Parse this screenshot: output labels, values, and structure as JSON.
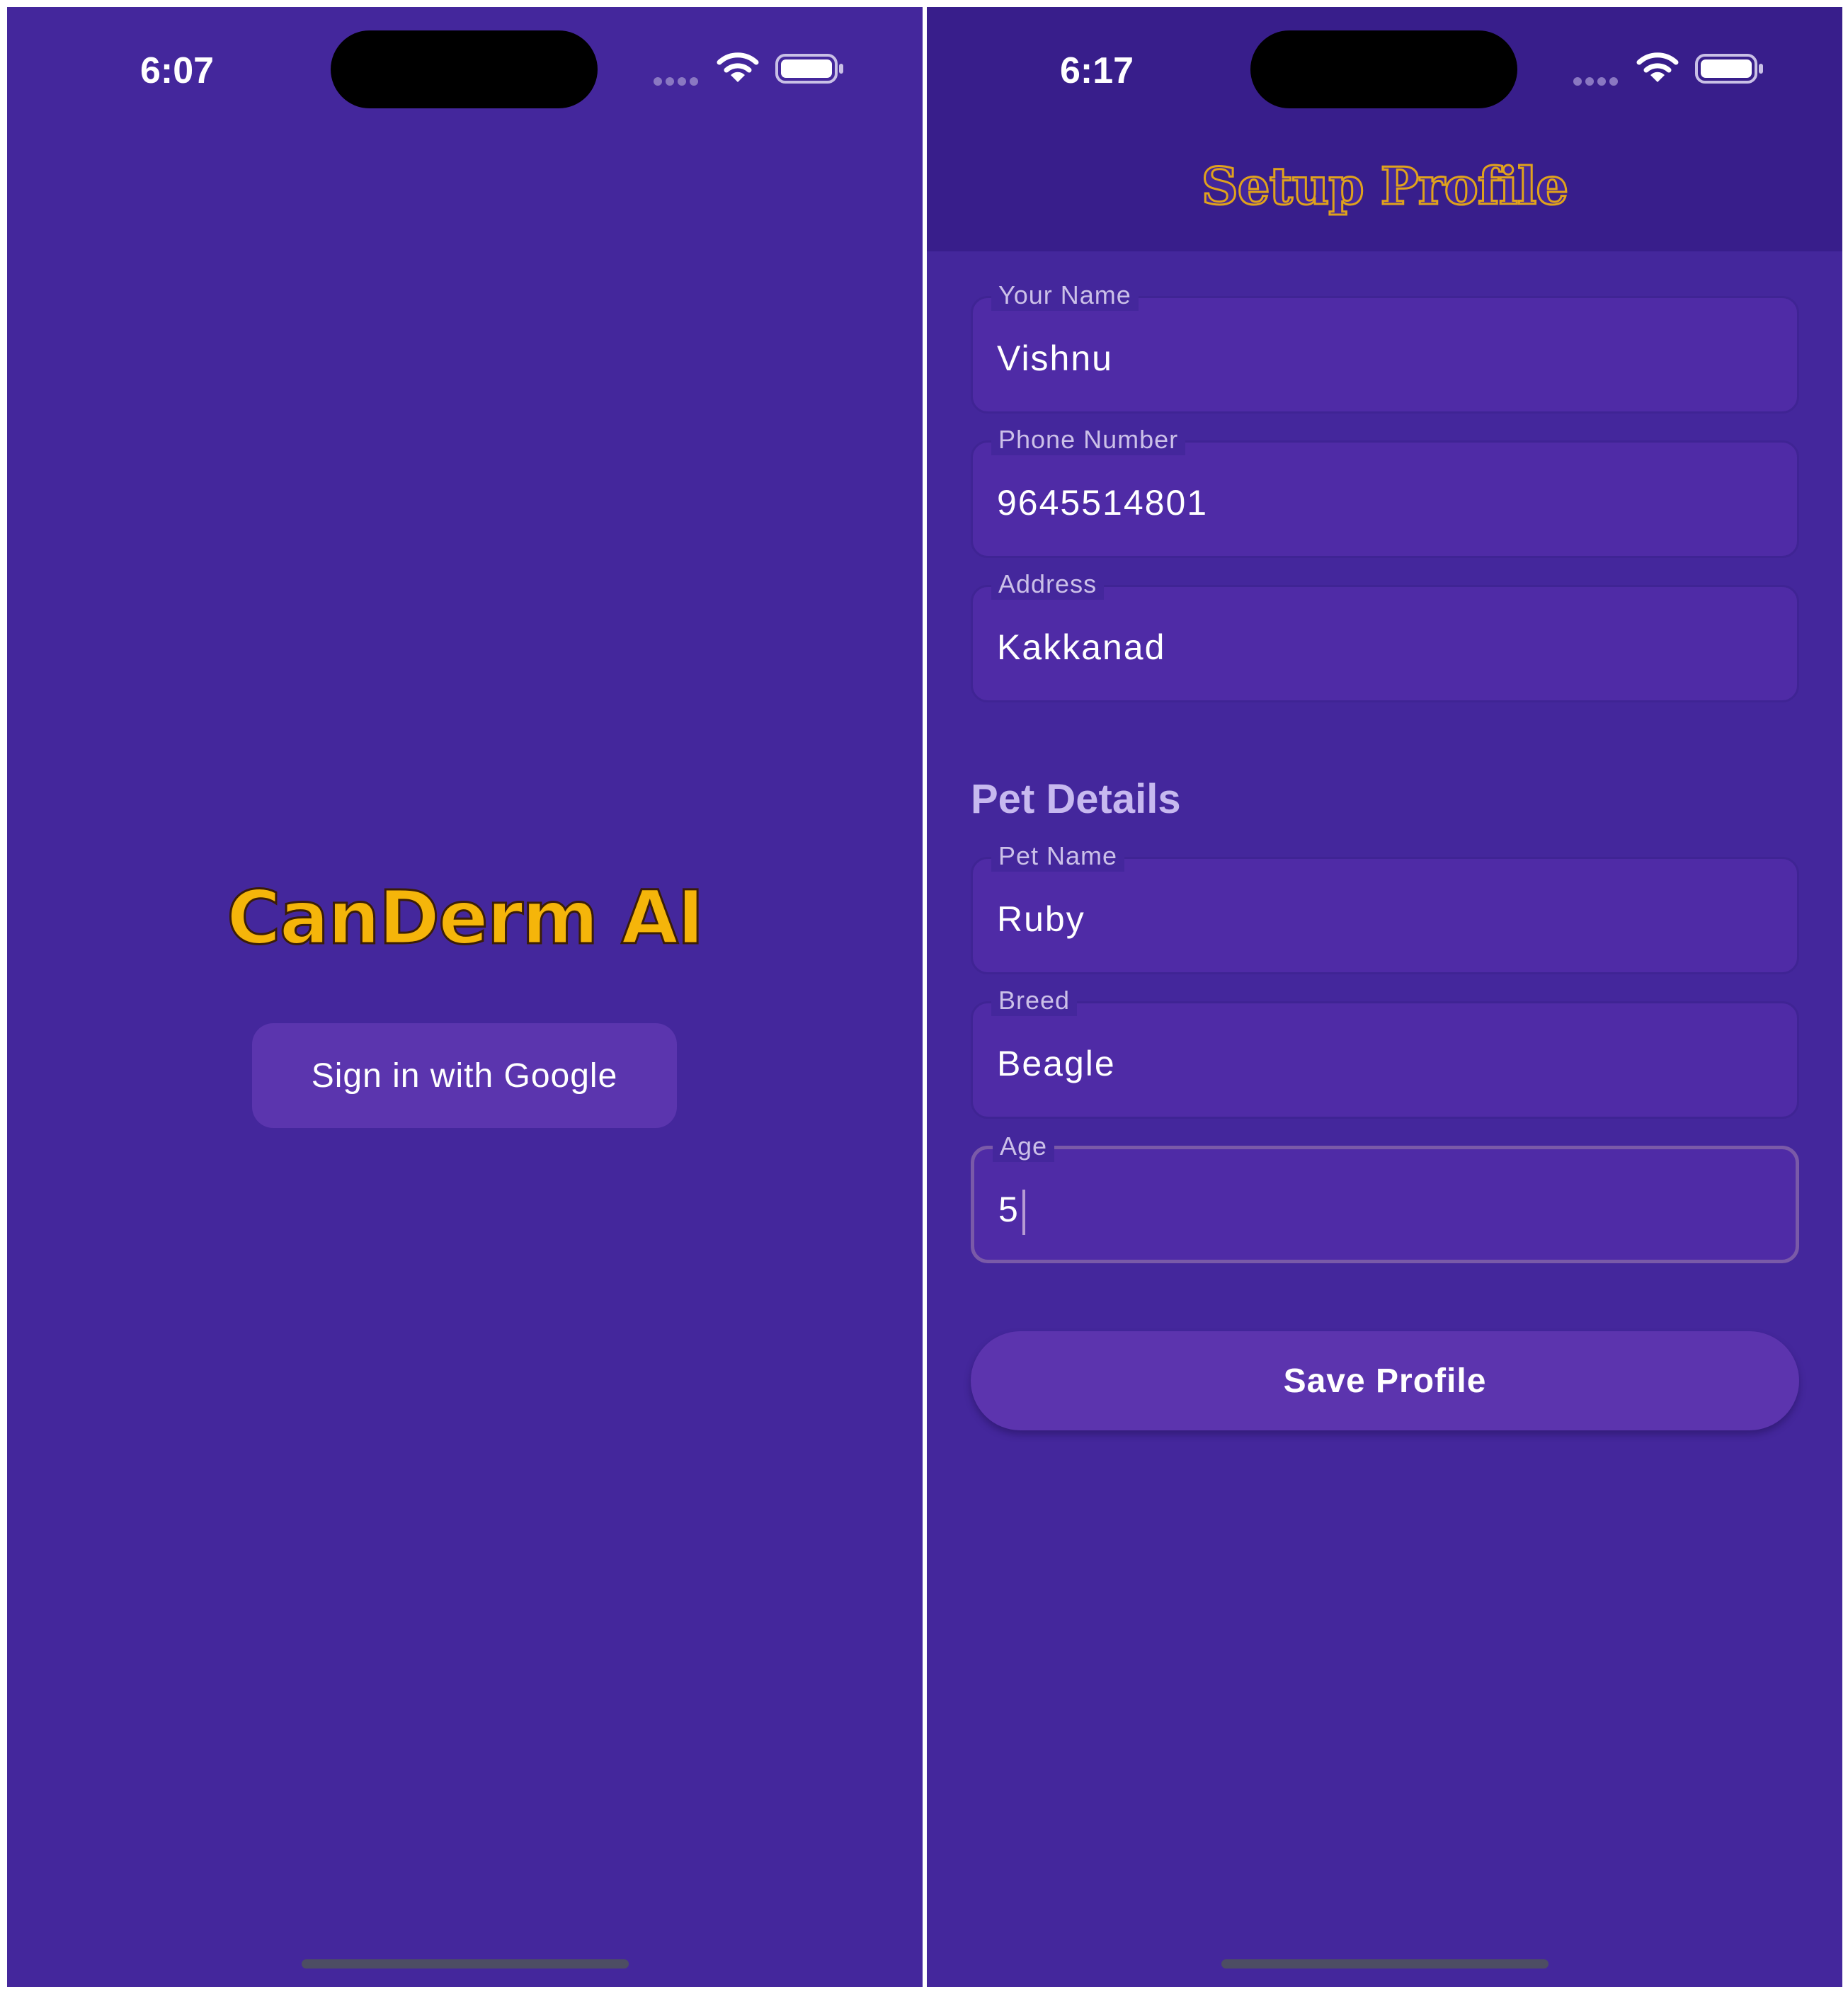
{
  "colors": {
    "background": "#44279c",
    "app_bar": "#381e8b",
    "field_fill": "#4f2ba6",
    "button_fill": "#5b35ae",
    "logo_yellow": "#f5b50a",
    "title_orange": "#e0a21c"
  },
  "left_screen": {
    "status_bar": {
      "time": "6:07",
      "icons": [
        "signal-icon",
        "wifi-icon",
        "battery-icon"
      ]
    },
    "logo_text": "CanDerm AI",
    "sign_in_button": "Sign in with Google"
  },
  "right_screen": {
    "status_bar": {
      "time": "6:17",
      "icons": [
        "signal-icon",
        "wifi-icon",
        "battery-icon"
      ]
    },
    "title": "Setup Profile",
    "owner_fields": [
      {
        "label": "Your Name",
        "value": "Vishnu"
      },
      {
        "label": "Phone Number",
        "value": "9645514801"
      },
      {
        "label": "Address",
        "value": "Kakkanad"
      }
    ],
    "pet_section_heading": "Pet Details",
    "pet_fields": [
      {
        "label": "Pet Name",
        "value": "Ruby"
      },
      {
        "label": "Breed",
        "value": "Beagle"
      },
      {
        "label": "Age",
        "value": "5"
      }
    ],
    "save_button": "Save Profile"
  }
}
